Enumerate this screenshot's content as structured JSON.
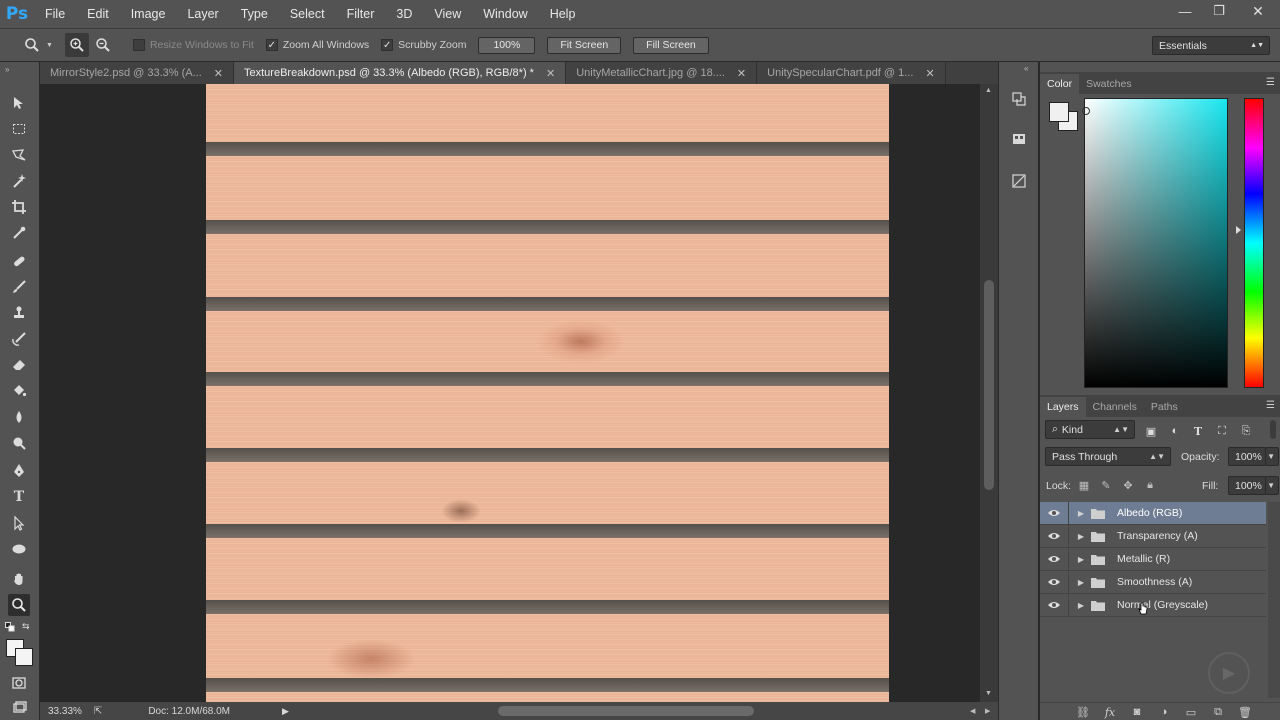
{
  "app": {
    "logo": "Ps"
  },
  "menu": [
    "File",
    "Edit",
    "Image",
    "Layer",
    "Type",
    "Select",
    "Filter",
    "3D",
    "View",
    "Window",
    "Help"
  ],
  "window_controls": {
    "minimize": "—",
    "restore": "❐",
    "close": "✕"
  },
  "options": {
    "resize_windows": "Resize Windows to Fit",
    "zoom_all": "Zoom All Windows",
    "scrubby_zoom": "Scrubby Zoom",
    "zoom_percent": "100%",
    "fit_screen": "Fit Screen",
    "fill_screen": "Fill Screen",
    "workspace": "Essentials"
  },
  "tabs": [
    {
      "label": "MirrorStyle2.psd @ 33.3% (A...",
      "active": false
    },
    {
      "label": "TextureBreakdown.psd @ 33.3% (Albedo (RGB), RGB/8*) *",
      "active": true
    },
    {
      "label": "UnityMetallicChart.jpg @ 18....",
      "active": false
    },
    {
      "label": "UnitySpecularChart.pdf @ 1...",
      "active": false
    }
  ],
  "tools": [
    "move-icon",
    "marquee-icon",
    "lasso-icon",
    "magic-wand-icon",
    "crop-icon",
    "eyedropper-icon",
    "healing-brush-icon",
    "brush-icon",
    "clone-stamp-icon",
    "history-brush-icon",
    "eraser-icon",
    "paint-bucket-icon",
    "blur-icon",
    "dodge-icon",
    "pen-icon",
    "type-icon",
    "path-selection-icon",
    "ellipse-icon",
    "hand-icon",
    "zoom-icon"
  ],
  "status": {
    "zoom": "33.33%",
    "doc": "Doc: 12.0M/68.0M"
  },
  "color_panel": {
    "tabs": [
      "Color",
      "Swatches"
    ],
    "fg_color": "#f0f0f0",
    "bg_color": "#f0f0f0"
  },
  "layers_panel": {
    "tabs": [
      "Layers",
      "Channels",
      "Paths"
    ],
    "filter_kind": "Kind",
    "blend_mode": "Pass Through",
    "opacity_label": "Opacity:",
    "opacity_value": "100%",
    "lock_label": "Lock:",
    "fill_label": "Fill:",
    "fill_value": "100%",
    "layers": [
      {
        "name": "Albedo (RGB)",
        "selected": true
      },
      {
        "name": "Transparency (A)",
        "selected": false
      },
      {
        "name": "Metallic (R)",
        "selected": false
      },
      {
        "name": "Smoothness (A)",
        "selected": false
      },
      {
        "name": "Normal (Greyscale)",
        "selected": false
      }
    ]
  }
}
